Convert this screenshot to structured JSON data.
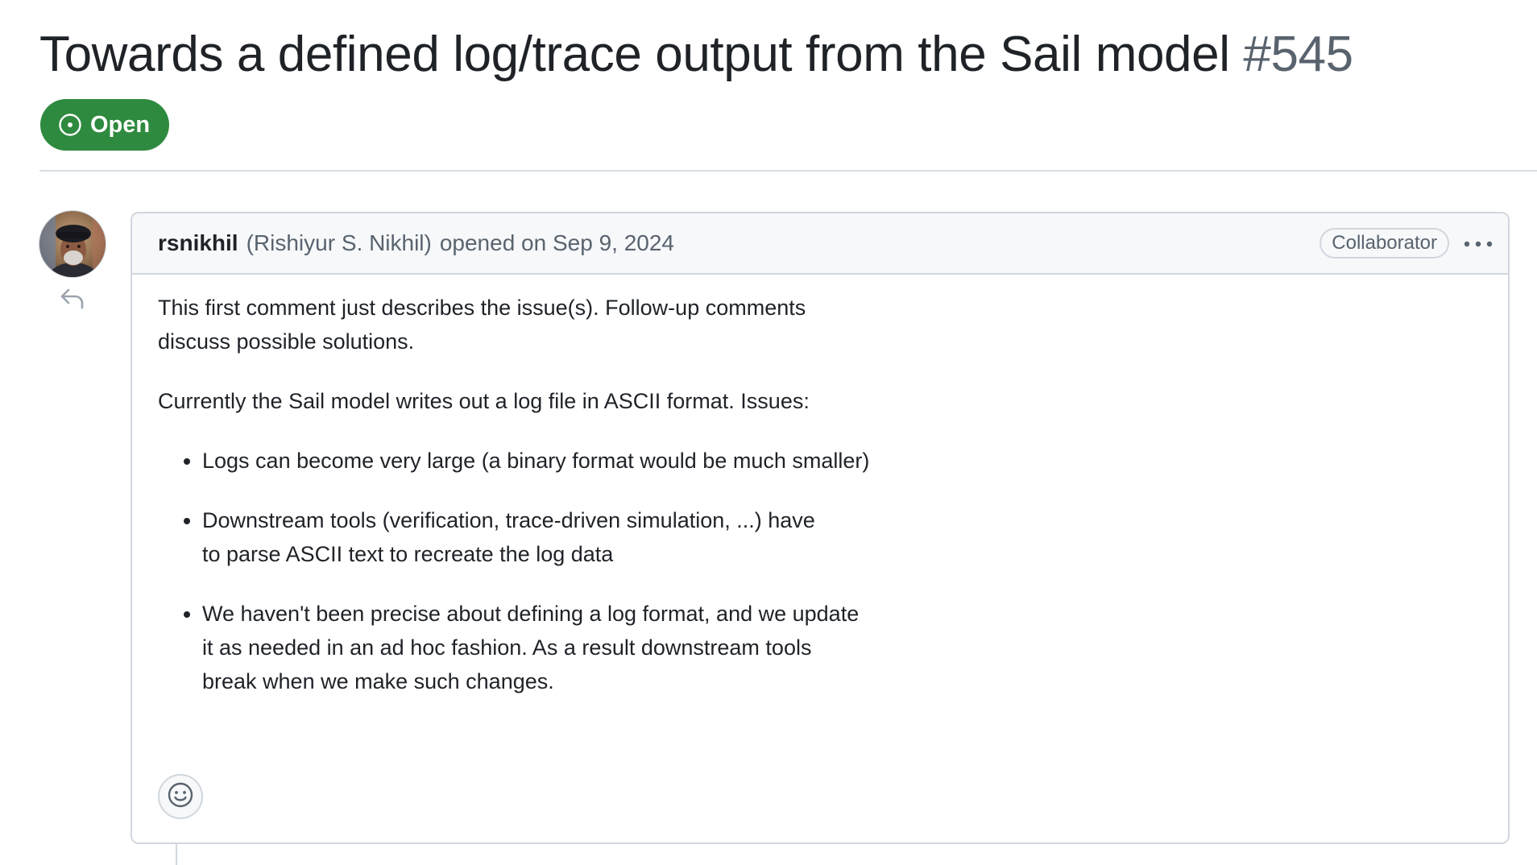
{
  "issue": {
    "title": "Towards a defined log/trace output from the Sail model",
    "number": "#545",
    "state": "Open",
    "state_color": "#2e8a3e"
  },
  "comment": {
    "author": "rsnikhil",
    "author_full_name": "(Rishiyur S. Nikhil)",
    "action": "opened on Sep 9, 2024",
    "role": "Collaborator",
    "body": {
      "paragraph1_line1": "This first comment just describes the issue(s). Follow-up comments",
      "paragraph1_line2": "discuss possible solutions.",
      "paragraph2": "Currently the Sail model writes out a log file in ASCII format. Issues:",
      "bullets": [
        {
          "lines": [
            "Logs can become very large (a binary format would be much smaller)"
          ]
        },
        {
          "lines": [
            "Downstream tools (verification, trace-driven simulation, ...) have",
            "to parse ASCII text to recreate the log data"
          ]
        },
        {
          "lines": [
            "We haven't been precise about defining a log format, and we update",
            "it as needed in an ad hoc fashion. As a result downstream tools",
            "break when we make such changes."
          ]
        }
      ]
    }
  },
  "icons": {
    "state": "issue-opened-icon",
    "reply": "reply-icon",
    "menu": "kebab-horizontal-icon",
    "reaction": "smiley-icon"
  }
}
